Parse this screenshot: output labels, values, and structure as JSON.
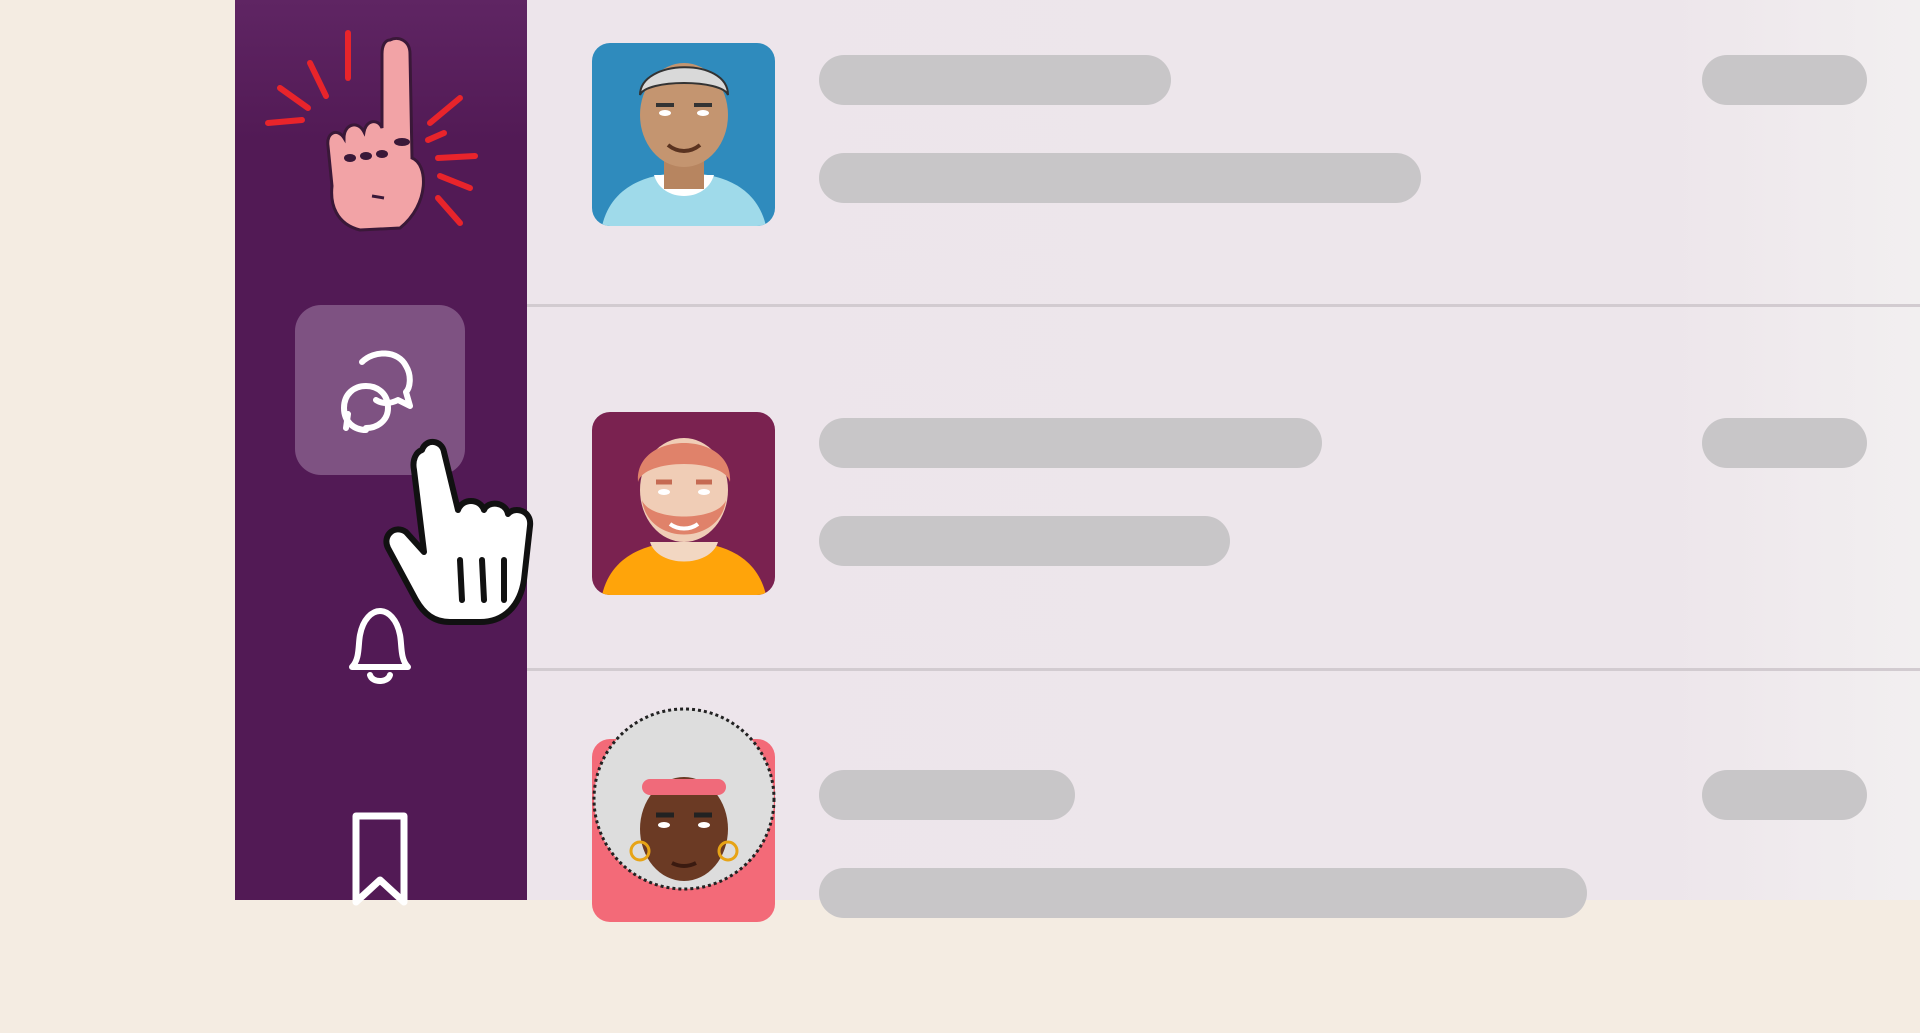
{
  "colors": {
    "sidebar": "#521a55",
    "sidebar_active": "#7e5282",
    "main_bg": "#ede5eb",
    "skeleton": "#c8c6c8",
    "background": "#f4ece2",
    "burst": "#e8242b"
  },
  "sidebar": {
    "items": [
      {
        "icon": "conversation-icon",
        "active": true
      },
      {
        "icon": "bell-icon",
        "active": false
      },
      {
        "icon": "bookmark-icon",
        "active": false
      }
    ]
  },
  "decorations": {
    "top_badge_icon": "raised-finger-hand-icon",
    "cursor_icon": "hand-pointer-cursor-icon"
  },
  "messages": [
    {
      "avatar": "man-short-gray-hair-blue-bg-avatar",
      "avatar_bg": "#2f8bbd",
      "shirt": "#9fdaea"
    },
    {
      "avatar": "man-red-beard-purple-bg-avatar",
      "avatar_bg": "#7a2250",
      "shirt": "#ffa40a"
    },
    {
      "avatar": "woman-afro-headband-pink-bg-avatar",
      "avatar_bg": "#f36a78",
      "shirt": "#f7b6c8"
    }
  ]
}
